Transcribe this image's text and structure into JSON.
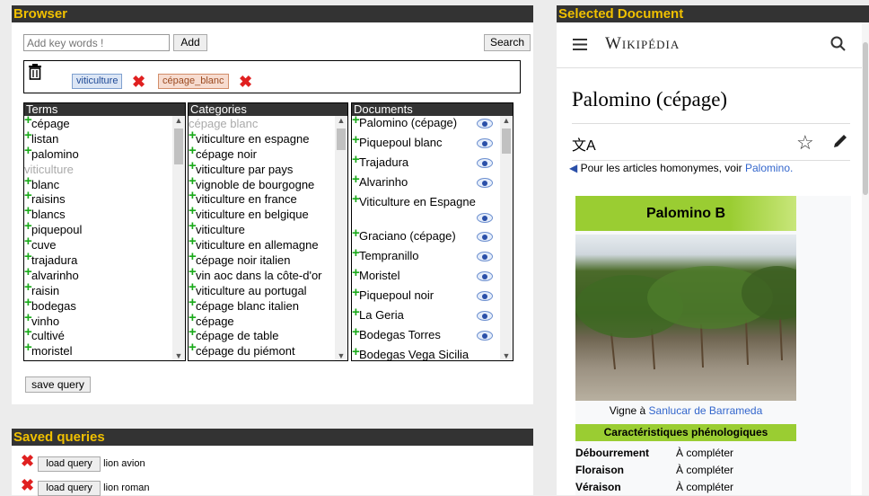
{
  "browser": {
    "title": "Browser",
    "keyword_placeholder": "Add key words !",
    "add_label": "Add",
    "search_label": "Search",
    "tags": [
      {
        "label": "viticulture",
        "color": "#dce6f5",
        "border": "#7fa0cf",
        "text": "#1f4a96"
      },
      {
        "label": "cépage_blanc",
        "color": "#f7dcd0",
        "border": "#d28e6b",
        "text": "#9b4a20"
      }
    ],
    "columns": {
      "terms": {
        "header": "Terms",
        "items": [
          {
            "label": "cépage",
            "active": true
          },
          {
            "label": "listan",
            "active": true
          },
          {
            "label": "palomino",
            "active": true
          },
          {
            "label": "viticulture",
            "active": false
          },
          {
            "label": "blanc",
            "active": true
          },
          {
            "label": "raisins",
            "active": true
          },
          {
            "label": "blancs",
            "active": true
          },
          {
            "label": "piquepoul",
            "active": true
          },
          {
            "label": "cuve",
            "active": true
          },
          {
            "label": "trajadura",
            "active": true
          },
          {
            "label": "alvarinho",
            "active": true
          },
          {
            "label": "raisin",
            "active": true
          },
          {
            "label": "bodegas",
            "active": true
          },
          {
            "label": "vinho",
            "active": true
          },
          {
            "label": "cultivé",
            "active": true
          },
          {
            "label": "moristel",
            "active": true
          }
        ]
      },
      "categories": {
        "header": "Categories",
        "items": [
          {
            "label": "cépage blanc",
            "active": false
          },
          {
            "label": "viticulture en espagne",
            "active": true
          },
          {
            "label": "cépage noir",
            "active": true
          },
          {
            "label": "viticulture par pays",
            "active": true
          },
          {
            "label": "vignoble de bourgogne",
            "active": true
          },
          {
            "label": "viticulture en france",
            "active": true
          },
          {
            "label": "viticulture en belgique",
            "active": true
          },
          {
            "label": "viticulture",
            "active": true
          },
          {
            "label": "viticulture en allemagne",
            "active": true
          },
          {
            "label": "cépage noir italien",
            "active": true
          },
          {
            "label": "vin aoc dans la côte-d'or",
            "active": true
          },
          {
            "label": "viticulture au portugal",
            "active": true
          },
          {
            "label": "cépage blanc italien",
            "active": true
          },
          {
            "label": "cépage",
            "active": true
          },
          {
            "label": "cépage de table",
            "active": true
          },
          {
            "label": "cépage du piémont",
            "active": true
          }
        ]
      },
      "documents": {
        "header": "Documents",
        "items": [
          "Palomino (cépage)",
          "Piquepoul blanc",
          "Trajadura",
          "Alvarinho",
          "Viticulture en Espagne",
          "Graciano (cépage)",
          "Tempranillo",
          "Moristel",
          "Piquepoul noir",
          "La Geria",
          "Bodegas Torres",
          "Bodegas Vega Sicilia"
        ]
      }
    },
    "save_query_label": "save query"
  },
  "saved_queries": {
    "title": "Saved queries",
    "load_label": "load query",
    "items": [
      "lion avion",
      "lion roman"
    ]
  },
  "selected_document": {
    "title": "Selected Document",
    "wiki_logo": "Wikipédia",
    "article_title": "Palomino (cépage)",
    "homonym_note": "Pour les articles homonymes, voir",
    "homonym_link": "Palomino.",
    "infobox_title": "Palomino B",
    "caption_prefix": "Vigne à",
    "caption_link": "Sanlucar de Barrameda",
    "section_title": "Caractéristiques phénologiques",
    "rows": [
      {
        "label": "Débourrement",
        "value": "À compléter"
      },
      {
        "label": "Floraison",
        "value": "À compléter"
      },
      {
        "label": "Véraison",
        "value": "À compléter"
      }
    ]
  },
  "icons": [
    "trash-icon",
    "remove-tag-icon",
    "add-icon",
    "eye-icon",
    "menu-icon",
    "search-icon",
    "translate-icon",
    "star-icon",
    "edit-icon",
    "disambiguation-icon"
  ],
  "colors": {
    "header_bg": "#333333",
    "header_text": "#f0c000",
    "plus": "#1aaa1a",
    "remove": "#e02020",
    "wiki_link": "#3366cc",
    "infobox_green": "#9acd32"
  }
}
